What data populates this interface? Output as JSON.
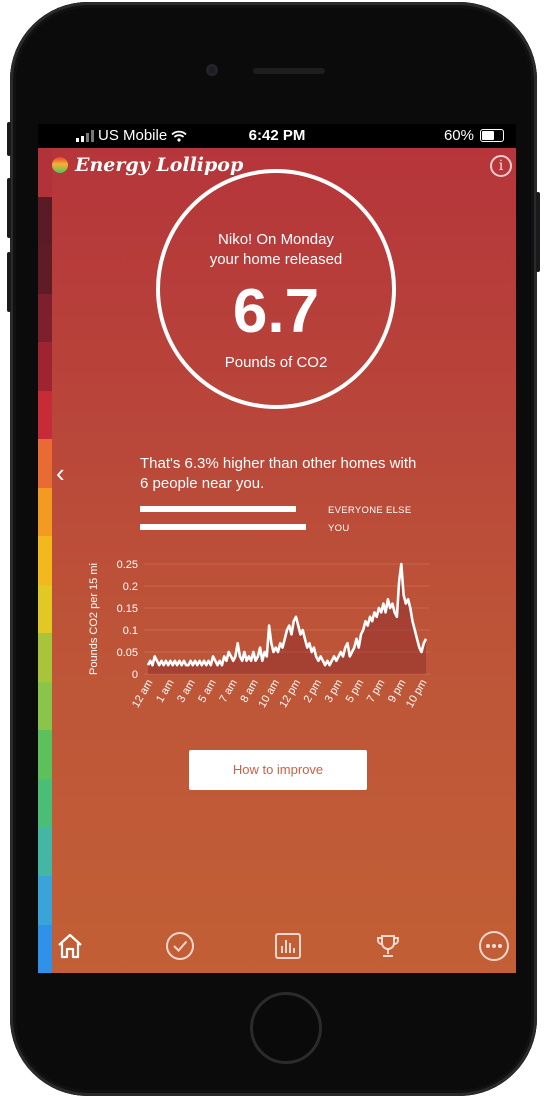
{
  "statusbar": {
    "carrier": "US Mobile",
    "time": "6:42 PM",
    "battery": "60%"
  },
  "app": {
    "name": "Energy Lollipop",
    "info_icon": "info-icon",
    "info_glyph": "i"
  },
  "summary": {
    "line1": "Niko! On Monday",
    "line2": "your home released",
    "value": "6.7",
    "unit": "Pounds of CO2"
  },
  "comparison": {
    "back_icon": "chevron-left-icon",
    "back_glyph": "‹",
    "text": "That's 6.3% higher than other homes with 6 people near you.",
    "everyone_label": "EVERYONE ELSE",
    "you_label": "YOU",
    "everyone_value": 0.937,
    "you_value": 1.0
  },
  "chart_data": {
    "type": "area",
    "ylabel": "Pounds CO2 per 15 mi",
    "xlabel": "",
    "ylim": [
      0,
      0.25
    ],
    "yticks": [
      "0.25",
      "0.2",
      "0.15",
      "0.1",
      "0.05",
      "0"
    ],
    "xticks": [
      "12 am",
      "1 am",
      "3 am",
      "5 am",
      "7 am",
      "8 am",
      "10 am",
      "12 pm",
      "2 pm",
      "3 pm",
      "5 pm",
      "7 pm",
      "9 pm",
      "10 pm"
    ],
    "x_start_hour": 0,
    "x_end_hour": 24,
    "series": [
      {
        "values": [
          0.02,
          0.03,
          0.02,
          0.04,
          0.03,
          0.02,
          0.03,
          0.02,
          0.03,
          0.02,
          0.03,
          0.02,
          0.03,
          0.02,
          0.03,
          0.02,
          0.03,
          0.02,
          0.02,
          0.03,
          0.02,
          0.03,
          0.02,
          0.03,
          0.02,
          0.03,
          0.02,
          0.03,
          0.02,
          0.04,
          0.03,
          0.02,
          0.03,
          0.02,
          0.04,
          0.03,
          0.05,
          0.04,
          0.03,
          0.04,
          0.07,
          0.04,
          0.03,
          0.05,
          0.03,
          0.04,
          0.03,
          0.05,
          0.03,
          0.04,
          0.06,
          0.03,
          0.05,
          0.04,
          0.11,
          0.07,
          0.05,
          0.06,
          0.05,
          0.07,
          0.06,
          0.08,
          0.1,
          0.11,
          0.09,
          0.12,
          0.13,
          0.11,
          0.09,
          0.1,
          0.08,
          0.06,
          0.07,
          0.05,
          0.06,
          0.04,
          0.03,
          0.04,
          0.03,
          0.02,
          0.03,
          0.02,
          0.03,
          0.04,
          0.03,
          0.04,
          0.05,
          0.04,
          0.06,
          0.07,
          0.04,
          0.05,
          0.06,
          0.08,
          0.06,
          0.09,
          0.1,
          0.12,
          0.11,
          0.13,
          0.12,
          0.14,
          0.13,
          0.15,
          0.14,
          0.16,
          0.14,
          0.17,
          0.15,
          0.16,
          0.14,
          0.13,
          0.21,
          0.25,
          0.18,
          0.16,
          0.17,
          0.15,
          0.12,
          0.1,
          0.08,
          0.06,
          0.05,
          0.07,
          0.08
        ]
      }
    ],
    "grid": true,
    "line_color": "#ffffff"
  },
  "cta": {
    "label": "How to improve"
  },
  "tabbar": {
    "home_icon": "home-icon",
    "check_icon": "check-circle-icon",
    "stats_icon": "bar-chart-icon",
    "trophy_icon": "trophy-icon",
    "more_icon": "more-icon"
  },
  "rainbow_colors": [
    "#b2323a",
    "#5a1a26",
    "#5f1c27",
    "#7d1f2d",
    "#9e2431",
    "#c62b37",
    "#ea6a33",
    "#f39a20",
    "#f2b81c",
    "#e2c824",
    "#a9c33a",
    "#8bc44b",
    "#5ec05c",
    "#4bbd76",
    "#44b6a6",
    "#3aa3d8",
    "#2f92e8"
  ],
  "colors": {
    "bg_top": "#b5343a",
    "bg_bottom": "#c25f36",
    "accent_text": "#d06040"
  }
}
